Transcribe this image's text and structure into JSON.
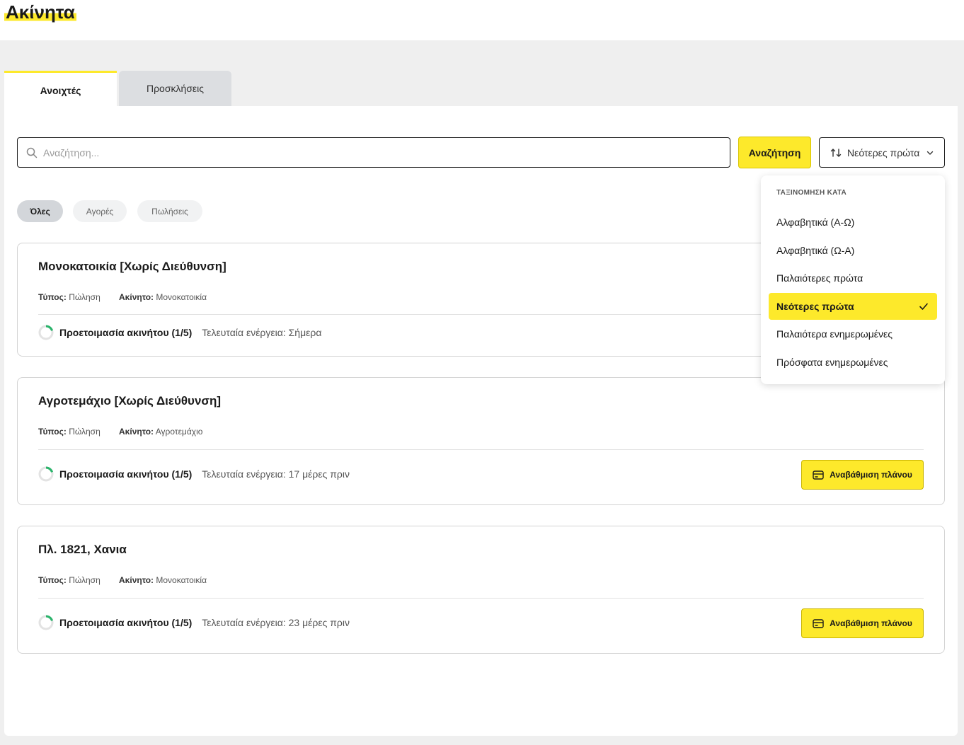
{
  "page": {
    "title": "Ακίνητα"
  },
  "tabs": [
    {
      "label": "Ανοιχτές",
      "active": true
    },
    {
      "label": "Προσκλήσεις",
      "active": false
    }
  ],
  "search": {
    "placeholder": "Αναζήτηση...",
    "value": "",
    "button_label": "Αναζήτηση"
  },
  "sort": {
    "current": "Νεότερες πρώτα"
  },
  "filters": [
    "Όλες",
    "Αγορές",
    "Πωλήσεις"
  ],
  "dropdown": {
    "header": "ΤΑΞΙΝΟΜΗΣΗ ΚΑΤΑ",
    "items": [
      "Αλφαβητικά (Α-Ω)",
      "Αλφαβητικά (Ω-Α)",
      "Παλαιότερες πρώτα",
      "Νεότερες πρώτα",
      "Παλαιότερα ενημερωμένες",
      "Πρόσφατα ενημερωμένες"
    ],
    "selected_index": 3
  },
  "labels": {
    "type": "Τύπος:",
    "property": "Ακίνητο:",
    "last_activity": "Τελευταία ενέργεια:",
    "upgrade": "Αναβάθμιση πλάνου"
  },
  "properties": [
    {
      "title": "Μονοκατοικία [Χωρίς Διεύθυνση]",
      "type": "Πώληση",
      "property_kind": "Μονοκατοικία",
      "progress_label": "Προετοιμασία ακινήτου (1/5)",
      "progress_fraction": 0.2,
      "last_activity": "Σήμερα"
    },
    {
      "title": "Αγροτεμάχιο [Χωρίς Διεύθυνση]",
      "type": "Πώληση",
      "property_kind": "Αγροτεμάχιο",
      "progress_label": "Προετοιμασία ακινήτου (1/5)",
      "progress_fraction": 0.2,
      "last_activity": "17 μέρες πριν"
    },
    {
      "title": "Πλ. 1821, Χανια",
      "type": "Πώληση",
      "property_kind": "Μονοκατοικία",
      "progress_label": "Προετοιμασία ακινήτου (1/5)",
      "progress_fraction": 0.2,
      "last_activity": "23 μέρες πριν"
    }
  ],
  "colors": {
    "accent": "#fde92b",
    "progress": "#2bb36b",
    "track": "#e3e3e3"
  }
}
